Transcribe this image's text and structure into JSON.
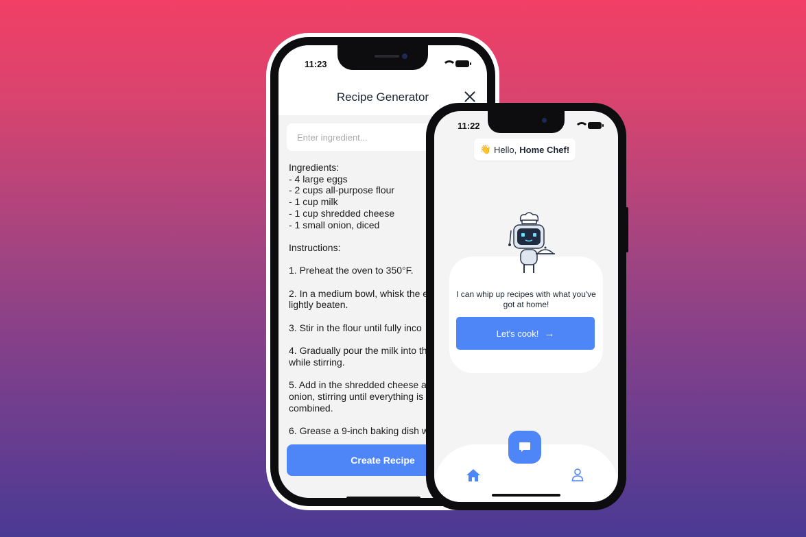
{
  "recipe_generator": {
    "status_time": "11:23",
    "title": "Recipe Generator",
    "input_placeholder": "Enter ingredient...",
    "recipe_lines": [
      "Ingredients:",
      "- 4 large eggs",
      "- 2 cups all-purpose flour",
      "- 1 cup milk",
      "- 1 cup shredded cheese",
      "- 1 small onion, diced",
      "",
      "Instructions:",
      "",
      "1. Preheat the oven to 350°F.",
      "",
      "2. In a medium bowl, whisk the e",
      "lightly beaten.",
      "",
      "3. Stir in the flour until fully inco",
      "",
      "4. Gradually pour the milk into th",
      "while stirring.",
      "",
      "5. Add in the shredded cheese a",
      "onion, stirring until everything is",
      "combined.",
      "",
      "6. Grease a 9-inch baking dish w"
    ],
    "create_button": "Create Recipe"
  },
  "home": {
    "status_time": "11:22",
    "greeting_prefix": "Hello,",
    "greeting_name": "Home Chef!",
    "greeting_emoji": "👋",
    "card_text": "I can whip up recipes with what you've got at home!",
    "cook_button": "Let's cook!",
    "tabs": [
      "home-icon",
      "chat-icon",
      "profile-icon"
    ]
  },
  "colors": {
    "accent": "#4f86f7",
    "background_top": "#f23f66",
    "background_bottom": "#4a3a94"
  }
}
